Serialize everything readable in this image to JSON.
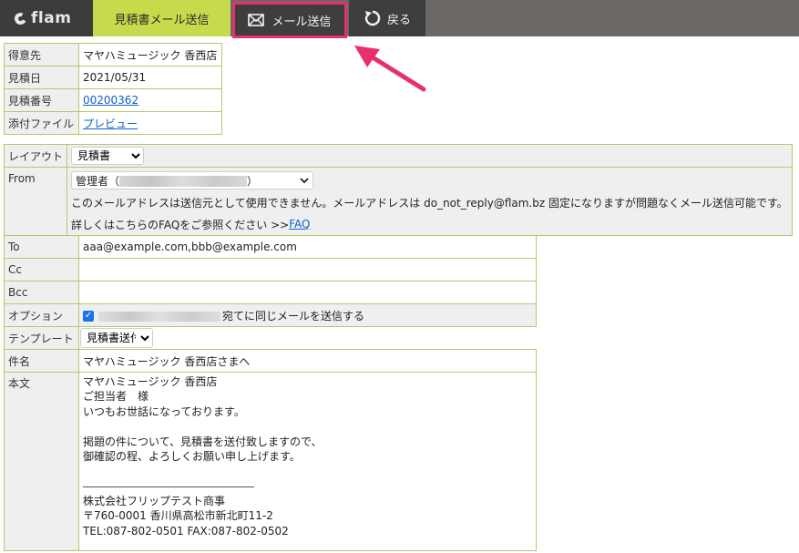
{
  "topbar": {
    "logo_text": "flam",
    "active_tab": "見積書メール送信",
    "send_button": "メール送信",
    "back_button": "戻る"
  },
  "info": {
    "customer_label": "得意先",
    "customer_value": "マヤハミュージック 香西店",
    "date_label": "見積日",
    "date_value": "2021/05/31",
    "number_label": "見積番号",
    "number_value": "00200362",
    "attach_label": "添付ファイル",
    "attach_value": "プレビュー"
  },
  "settings": {
    "layout_label": "レイアウト",
    "layout_value": "見積書",
    "from_label": "From",
    "from_value_prefix": "管理者（",
    "from_value_suffix": "）",
    "from_notice": "このメールアドレスは送信元として使用できません。メールアドレスは do_not_reply@flam.bz 固定になりますが問題なくメール送信可能です。",
    "from_faq_text": "詳しくはこちらのFAQをご参照ください >> ",
    "from_faq_link": "FAQ"
  },
  "mail": {
    "to_label": "To",
    "to_value": "aaa@example.com,bbb@example.com",
    "cc_label": "Cc",
    "cc_value": "",
    "bcc_label": "Bcc",
    "bcc_value": "",
    "option_label": "オプション",
    "option_text": "宛てに同じメールを送信する",
    "option_checked": true,
    "template_label": "テンプレート",
    "template_value": "見積書送付",
    "subject_label": "件名",
    "subject_value": "マヤハミュージック 香西店さまへ",
    "body_label": "本文",
    "body_lines": [
      "マヤハミュージック 香西店",
      "ご担当者　様",
      "いつもお世話になっております。",
      "",
      "掲題の件について、見積書を送付致しますので、",
      "御確認の程、よろしくお願い申し上げます。",
      "",
      "",
      "株式会社フリップテスト商事",
      "〒760-0001 香川県高松市新北町11-2",
      "TEL:087-802-0501 FAX:087-802-0502"
    ]
  },
  "colors": {
    "active_tab": "#c7da4b",
    "highlight": "#e8306e",
    "table_border": "#b5c96a"
  }
}
